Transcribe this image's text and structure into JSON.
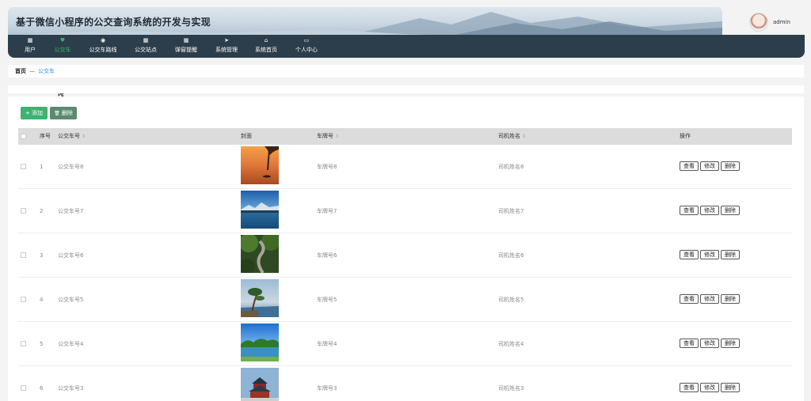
{
  "site": {
    "title": "基于微信小程序的公交查询系统的开发与实现"
  },
  "user": {
    "name": "admin"
  },
  "nav": [
    {
      "label": "用户",
      "icon": "▦",
      "active": false
    },
    {
      "label": "公交车",
      "icon": "♥",
      "active": true
    },
    {
      "label": "公交车路线",
      "icon": "◉",
      "active": false
    },
    {
      "label": "公交站点",
      "icon": "▦",
      "active": false
    },
    {
      "label": "弹窗提醒",
      "icon": "▦",
      "active": false
    },
    {
      "label": "系统管理",
      "icon": "➤",
      "active": false
    },
    {
      "label": "系统首页",
      "icon": "⌂",
      "active": false
    },
    {
      "label": "个人中心",
      "icon": "▭",
      "active": false
    }
  ],
  "breadcrumb": {
    "home": "首页",
    "separator": "—",
    "current": "公交车"
  },
  "toolbar": {
    "add_label": "添加",
    "add_icon": "+",
    "delete_label": "删除",
    "delete_icon": "🗑"
  },
  "table": {
    "headers": {
      "index": "序号",
      "bus_no": "公交车号",
      "cover": "封面",
      "plate": "车牌号",
      "driver": "司机姓名",
      "actions": "操作"
    },
    "rows": [
      {
        "index": "1",
        "bus_no": "公交车号8",
        "plate": "车牌号8",
        "driver": "司机姓名8"
      },
      {
        "index": "2",
        "bus_no": "公交车号7",
        "plate": "车牌号7",
        "driver": "司机姓名7"
      },
      {
        "index": "3",
        "bus_no": "公交车号6",
        "plate": "车牌号6",
        "driver": "司机姓名6"
      },
      {
        "index": "4",
        "bus_no": "公交车号5",
        "plate": "车牌号5",
        "driver": "司机姓名5"
      },
      {
        "index": "5",
        "bus_no": "公交车号4",
        "plate": "车牌号4",
        "driver": "司机姓名4"
      },
      {
        "index": "6",
        "bus_no": "公交车号3",
        "plate": "车牌号3",
        "driver": "司机姓名3"
      }
    ],
    "actions": {
      "view": "查看",
      "edit": "修改",
      "delete": "删除"
    }
  },
  "colors": {
    "accent": "#3cb371",
    "nav_bg": "#2c3e4b",
    "link": "#3a8ee6"
  }
}
